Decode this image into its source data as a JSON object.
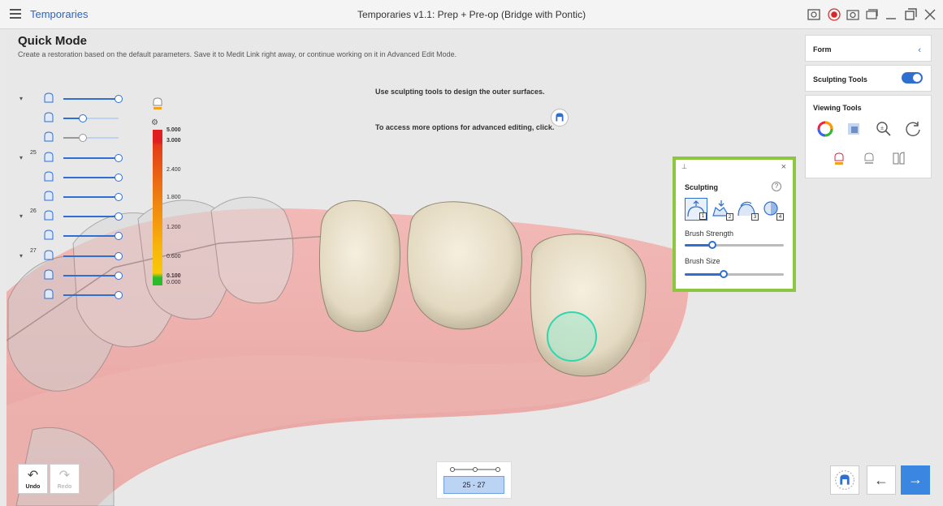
{
  "titlebar": {
    "app_name": "Temporaries",
    "window_title": "Temporaries v1.1: Prep + Pre-op (Bridge with Pontic)"
  },
  "header": {
    "title": "Quick Mode",
    "description": "Create a restoration based on the default parameters. Save it to Medit Link right away, or continue working on it in Advanced Edit Mode."
  },
  "hints": {
    "line1": "Use sculpting tools to design the outer surfaces.",
    "line2": "To access more options for advanced editing, click"
  },
  "tree": {
    "rows": [
      {
        "num": "",
        "icon": "document-icon",
        "value": 1.0,
        "expand": true
      },
      {
        "num": "",
        "icon": "scan-jaw-icon",
        "value": 0.35,
        "expand": false
      },
      {
        "num": "",
        "icon": "antagonist-icon",
        "value": 0.35,
        "expand": false
      },
      {
        "num": "25",
        "icon": "crown-icon",
        "value": 1.0,
        "expand": true
      },
      {
        "num": "",
        "icon": "inner-crown-icon",
        "value": 1.0,
        "expand": false
      },
      {
        "num": "",
        "icon": "abutment-icon",
        "value": 1.0,
        "expand": false
      },
      {
        "num": "26",
        "icon": "crown-icon",
        "value": 1.0,
        "expand": true
      },
      {
        "num": "",
        "icon": "inner-crown-icon",
        "value": 1.0,
        "expand": false
      },
      {
        "num": "27",
        "icon": "crown-icon",
        "value": 1.0,
        "expand": true
      },
      {
        "num": "",
        "icon": "inner-crown-icon",
        "value": 1.0,
        "expand": false
      },
      {
        "num": "",
        "icon": "abutment-icon",
        "value": 1.0,
        "expand": false
      }
    ]
  },
  "color_scale": {
    "labels": [
      "5.000",
      "3.000",
      "2.400",
      "1.800",
      "1.200",
      "0.600",
      "0.100",
      "0.000"
    ]
  },
  "panels": {
    "form": "Form",
    "sculpting_tools": "Sculpting Tools",
    "viewing_tools": "Viewing Tools"
  },
  "sculpting": {
    "title": "Sculpting",
    "help": "?",
    "brushes": [
      "1",
      "2",
      "3",
      "4"
    ],
    "brush_strength_label": "Brush Strength",
    "brush_strength": 0.28,
    "brush_size_label": "Brush Size",
    "brush_size": 0.39
  },
  "bottom": {
    "undo": "Undo",
    "redo": "Redo",
    "range": "25 - 27"
  },
  "colors": {
    "accent": "#2f6fd0",
    "highlight": "#8dc63f",
    "next": "#3a86e0"
  }
}
